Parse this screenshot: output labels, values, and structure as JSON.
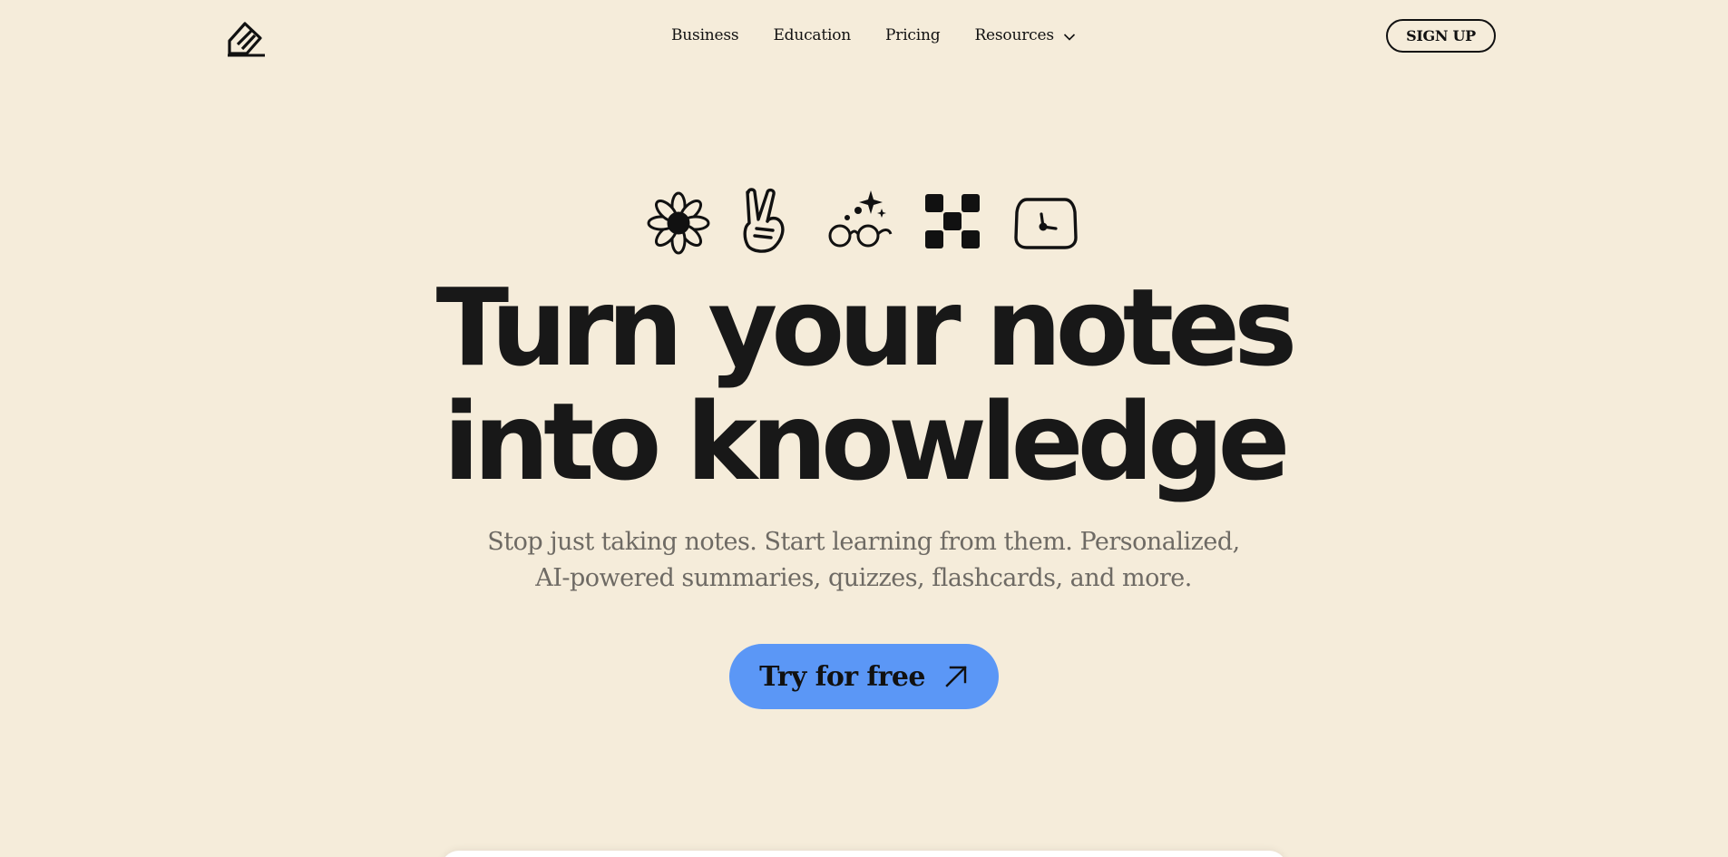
{
  "nav": {
    "links": [
      {
        "label": "Business"
      },
      {
        "label": "Education"
      },
      {
        "label": "Pricing"
      },
      {
        "label": "Resources"
      }
    ],
    "signup_label": "SIGN UP"
  },
  "hero": {
    "icons": [
      "flower-icon",
      "peace-hand-icon",
      "sparkle-glasses-icon",
      "checker-icon",
      "clock-icon"
    ],
    "headline_line1": "Turn your notes",
    "headline_line2": "into knowledge",
    "subtitle_line1": "Stop just taking notes. Start learning from them. Personalized,",
    "subtitle_line2": "AI-powered summaries, quizzes, flashcards, and more.",
    "cta_label": "Try for free"
  },
  "colors": {
    "background": "#f5ecda",
    "cta": "#5b97f6",
    "text": "#111111",
    "subtitle": "#6e6a64"
  }
}
